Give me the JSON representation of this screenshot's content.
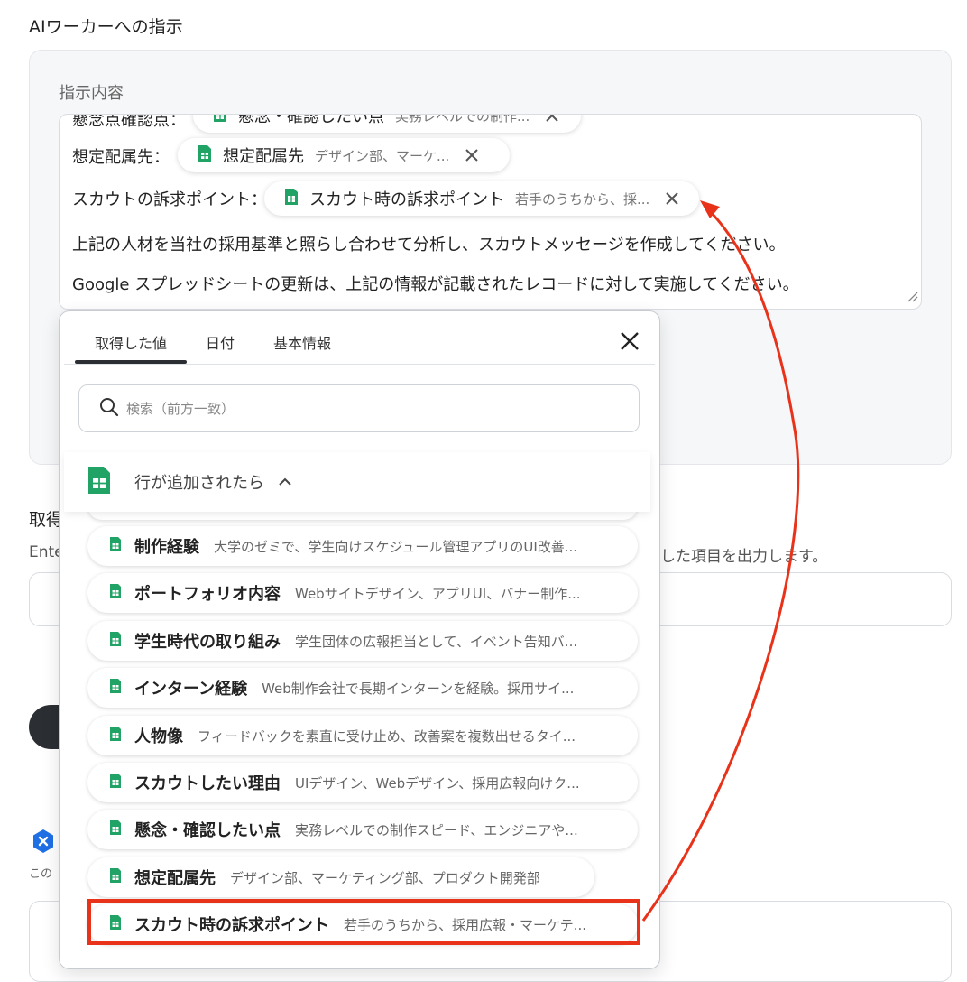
{
  "section_title": "AIワーカーへの指示",
  "card_label": "指示内容",
  "editor": {
    "row1_label": "懸念点確認点：",
    "row1_chip": {
      "title": "懸念・確認したい点",
      "value": "実務レベルでの制作..."
    },
    "row2_label": "想定配属先：",
    "row2_chip": {
      "title": "想定配属先",
      "value": "デザイン部、マーケ..."
    },
    "row3_label": "スカウトの訴求ポイント：",
    "row3_chip": {
      "title": "スカウト時の訴求ポイント",
      "value": "若手のうちから、採..."
    },
    "line4": "上記の人材を当社の採用基準と照らし合わせて分析し、スカウトメッセージを作成してください。",
    "line5": "Google スプレッドシートの更新は、上記の情報が記載されたレコードに対して実施してください。"
  },
  "background": {
    "title_partial": "取得",
    "desc_partial": "Ente",
    "desc_right": "した項目を出力します。",
    "small_partial": "この"
  },
  "popup": {
    "tabs": [
      "取得した値",
      "日付",
      "基本情報"
    ],
    "search_placeholder": "検索（前方一致）",
    "group_title": "行が追加されたら",
    "items": [
      {
        "title": "制作経験",
        "value": "大学のゼミで、学生向けスケジュール管理アプリのUI改善..."
      },
      {
        "title": "ポートフォリオ内容",
        "value": "Webサイトデザイン、アプリUI、バナー制作..."
      },
      {
        "title": "学生時代の取り組み",
        "value": "学生団体の広報担当として、イベント告知バ..."
      },
      {
        "title": "インターン経験",
        "value": "Web制作会社で長期インターンを経験。採用サイ..."
      },
      {
        "title": "人物像",
        "value": "フィードバックを素直に受け止め、改善案を複数出せるタイ..."
      },
      {
        "title": "スカウトしたい理由",
        "value": "UIデザイン、Webデザイン、採用広報向けク..."
      },
      {
        "title": "懸念・確認したい点",
        "value": "実務レベルでの制作スピード、エンジニアや..."
      },
      {
        "title": "想定配属先",
        "value": "デザイン部、マーケティング部、プロダクト開発部"
      },
      {
        "title": "スカウト時の訴求ポイント",
        "value": "若手のうちから、採用広報・マーケテ..."
      }
    ]
  },
  "colors": {
    "sheet_green": "#21a366",
    "annotation_red": "#e8321a",
    "dark_button": "#2b2e33"
  },
  "icons": [
    "sheet-icon",
    "close-icon",
    "search-icon",
    "chevron-up-icon",
    "resize-handle-icon"
  ]
}
